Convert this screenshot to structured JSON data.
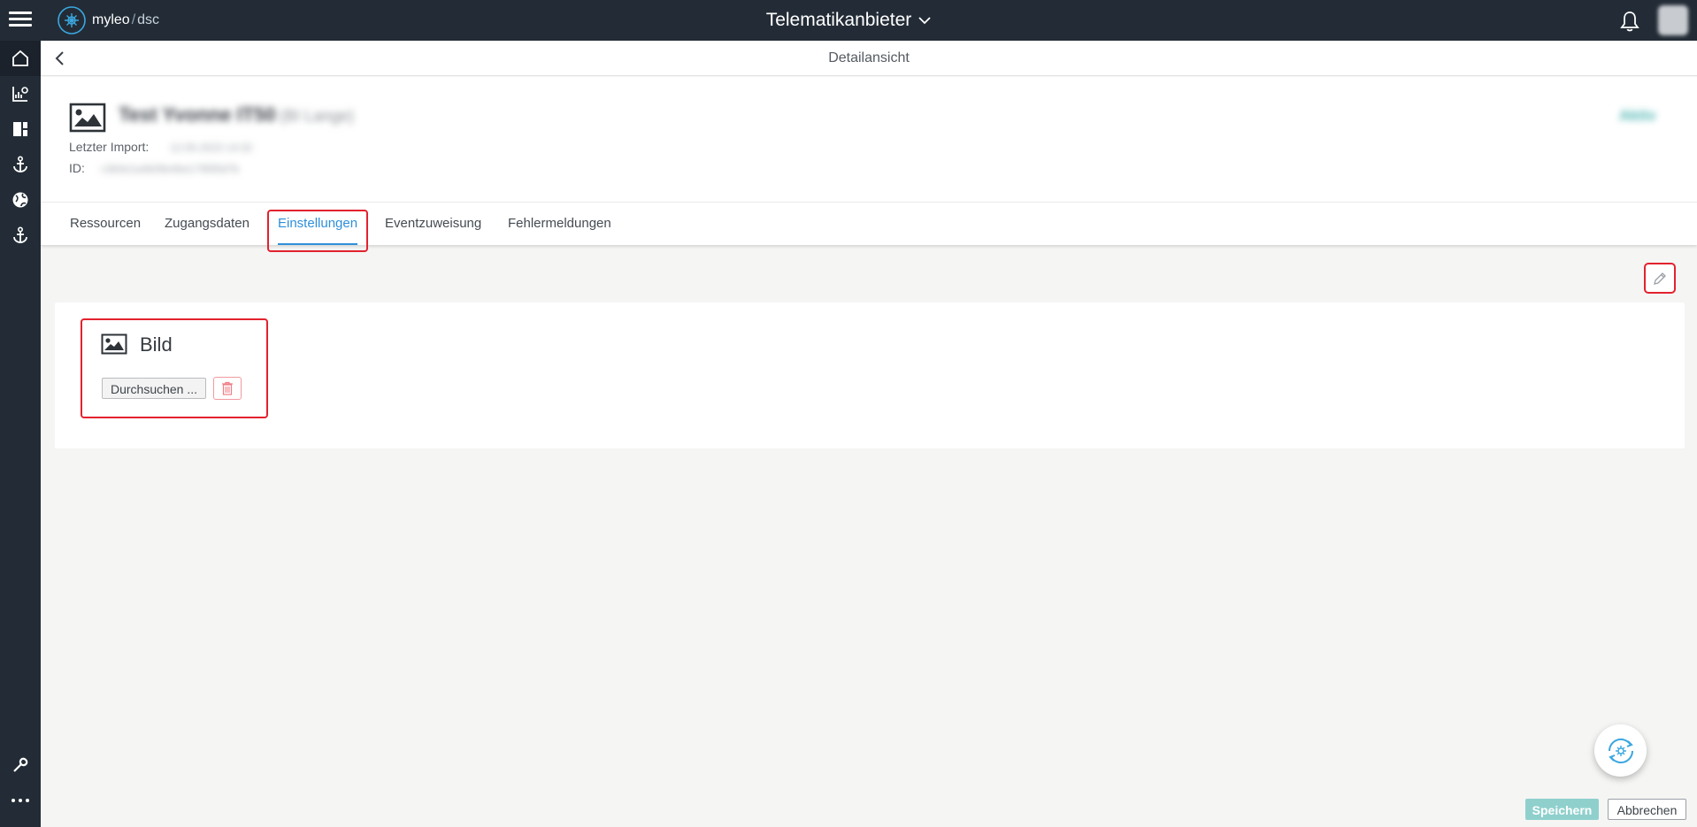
{
  "topbar": {
    "logo_name": "myleo",
    "logo_slash": "/",
    "logo_suffix": "dsc",
    "app_title": "Telematikanbieter"
  },
  "header": {
    "page_title": "Detailansicht"
  },
  "entity": {
    "name": "Test Yvonne IT50",
    "subtitle": "(BI Lange)",
    "status": "Aktiv",
    "last_import_label": "Letzter Import:",
    "last_import_value": "12.05.2023 14:32",
    "id_label": "ID:",
    "id_value": "c3b0e1a4b09e4be1795f0d7b"
  },
  "tabs": [
    {
      "label": "Ressourcen"
    },
    {
      "label": "Zugangsdaten"
    },
    {
      "label": "Einstellungen"
    },
    {
      "label": "Eventzuweisung"
    },
    {
      "label": "Fehlermeldungen"
    }
  ],
  "active_tab": "Einstellungen",
  "settings": {
    "image_section_title": "Bild",
    "browse_label": "Durchsuchen ..."
  },
  "footer": {
    "save_label": "Speichern",
    "cancel_label": "Abbrechen"
  },
  "colors": {
    "topbar": "#232c36",
    "accent": "#2f8fd9",
    "teal": "#49b3b0",
    "highlight": "#e3222e"
  },
  "icons": {
    "menu": "hamburger-icon",
    "logo": "myleo-logo-icon",
    "dropdown": "chevron-down-icon",
    "notifications": "bell-icon",
    "rail": [
      "home-icon",
      "chart-icon",
      "dashboard-icon",
      "anchor-icon",
      "globe-icon",
      "anchor-icon",
      "wrench-icon",
      "more-icon"
    ],
    "back": "chevron-left-icon",
    "image": "image-icon",
    "edit": "pencil-icon",
    "delete": "trash-icon",
    "fab": "refresh-icon"
  }
}
